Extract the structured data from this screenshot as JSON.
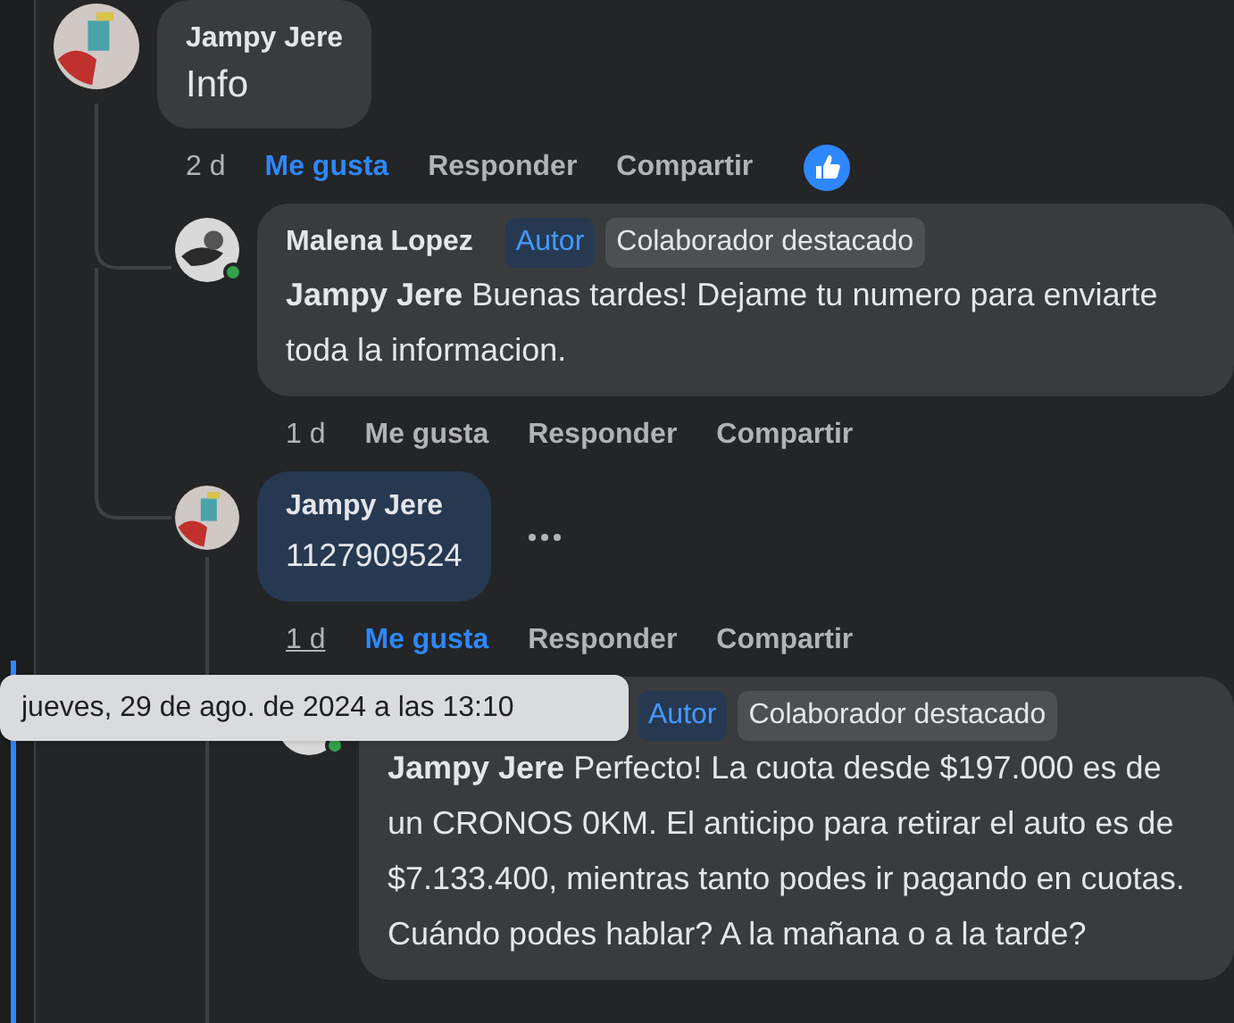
{
  "comments": [
    {
      "author": "Jampy Jere",
      "text": "Info",
      "highlighted": false,
      "time": "2 d",
      "time_underlined": false,
      "like_reaction": true,
      "actions": [
        {
          "label": "Me gusta",
          "active": true
        },
        {
          "label": "Responder",
          "active": false
        },
        {
          "label": "Compartir",
          "active": false
        }
      ],
      "children": [
        {
          "author": "Malena Lopez",
          "badges": [
            {
              "label": "Autor",
              "kind": "author"
            },
            {
              "label": "Colaborador destacado",
              "kind": "top"
            }
          ],
          "text": "**Jampy Jere** Buenas tardes! Dejame tu numero para enviarte toda la informacion.",
          "online": true,
          "highlighted": false,
          "time": "1 d",
          "time_underlined": false,
          "actions": [
            {
              "label": "Me gusta",
              "active": false
            },
            {
              "label": "Responder",
              "active": false
            },
            {
              "label": "Compartir",
              "active": false
            }
          ]
        },
        {
          "author": "Jampy Jere",
          "text": "1127909524",
          "highlighted": true,
          "menu_shown": true,
          "time": "1 d",
          "time_underlined": true,
          "actions": [
            {
              "label": "Me gusta",
              "active": true
            },
            {
              "label": "Responder",
              "active": false
            },
            {
              "label": "Compartir",
              "active": false
            }
          ],
          "children": [
            {
              "badges": [
                {
                  "label": "Autor",
                  "kind": "author"
                },
                {
                  "label": "Colaborador destacado",
                  "kind": "top"
                }
              ],
              "text": "**Jampy Jere** Perfecto! La cuota desde $197.000 es de un CRONOS 0KM. El anticipo para retirar el auto es de $7.133.400, mientras tanto podes ir pagando en cuotas. Cuándo podes hablar? A la mañana o a la tarde?",
              "online": true,
              "highlighted": false
            }
          ]
        }
      ]
    }
  ],
  "tooltip": {
    "text": "jueves, 29 de ago. de 2024 a las 13:10"
  }
}
